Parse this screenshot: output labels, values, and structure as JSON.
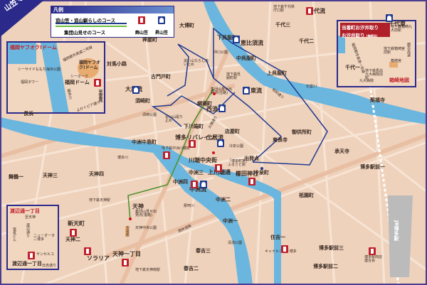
{
  "title": "山笠マップ",
  "legend": {
    "heading": "凡例",
    "course_main": "追山笠・追山馴らしのコース",
    "course_shudan": "集団山見せのコース",
    "kazariyama": "飾山笠",
    "noboriyama": "昇山笠"
  },
  "colors": {
    "land": "#efd2bc",
    "road": "#f7e4d4",
    "river": "#6bb6de",
    "course_main": "#1f3a8f",
    "course_shudan": "#6bbf3a",
    "kazariyama": "#c0202a",
    "noboriyama": "#1f3a8f",
    "frame": "#2b2a8a"
  },
  "insets": {
    "dome": {
      "title": "福岡ヤフオク!ドーム",
      "labels": [
        "福岡都市高速二号線",
        "シーサイドももち海浜公園",
        "福岡ヤフオク!ドーム",
        "シーホーク",
        "福岡ドーム",
        "福岡タワー",
        "樋井川",
        "よかトピア通り",
        "至室見"
      ]
    },
    "watanabe": {
      "title": "渡辺通一丁目",
      "labels": [
        "至天神",
        "渡辺通り",
        "電気ビル",
        "ニューオータニ博多",
        "サンセルコ",
        "渡辺通一丁目",
        "日赤通り"
      ]
    },
    "hakozaki": {
      "title": "箱崎地図",
      "banner_line1": "当番町お汐井取り",
      "banner_line2": "お汐井取り",
      "banner_note": "(箱崎浜)",
      "labels": [
        "地下鉄箱崎九大前駅",
        "地下鉄箱崎宮前駅",
        "箱崎宮",
        "地下鉄馬出九大病院前駅",
        "九大病院",
        "都市高速",
        "福岡都市高速一号線"
      ]
    }
  },
  "places": [
    "大博町",
    "神屋町",
    "対馬小路",
    "古門戸町",
    "追い山ならし追い止め",
    "大黒流",
    "須崎町",
    "下呉服町",
    "恵比須流",
    "中呉服町",
    "上呉服町",
    "千代三",
    "千代二",
    "千代流",
    "千代東",
    "千代一",
    "地下鉄千代県庁口駅",
    "沖口公園",
    "東流",
    "西流",
    "綱場町",
    "集団山見せ出発点(往路)",
    "地下鉄呉服町駅",
    "追い山廻り止め",
    "下川端町",
    "店屋町",
    "土居流",
    "冷泉公園",
    "博多リバレイン",
    "中洲中島町",
    "地下鉄中洲川端駅",
    "川端中央街",
    "中洲三",
    "上川端通",
    "中洲四",
    "中洲流",
    "櫛田神社",
    "出発点",
    "冷泉町",
    "「博多町家」ふるさと館",
    "東長寺",
    "御供所町",
    "承天寺",
    "聖福寺",
    "天神",
    "集団山見せ出発点(復路)",
    "天神中央公園",
    "市役所",
    "中洲二",
    "中洲一",
    "那珂川",
    "清流公園",
    "春吉三",
    "春吉二",
    "国体道路",
    "天神一丁目",
    "地下鉄天神南駅",
    "新天町",
    "天神二",
    "ソラリア",
    "地下鉄天神駅",
    "舞鶴一",
    "長浜一",
    "天神三",
    "天神四",
    "住吉一",
    "キャナルシティ博多",
    "博多駅前一",
    "博多駅前二",
    "博多駅前三",
    "祇園町",
    "博多駅商店連合会",
    "JR博多駅",
    "須崎公園",
    "博多川",
    "石堂川",
    "昭和通り",
    "大博通り"
  ]
}
